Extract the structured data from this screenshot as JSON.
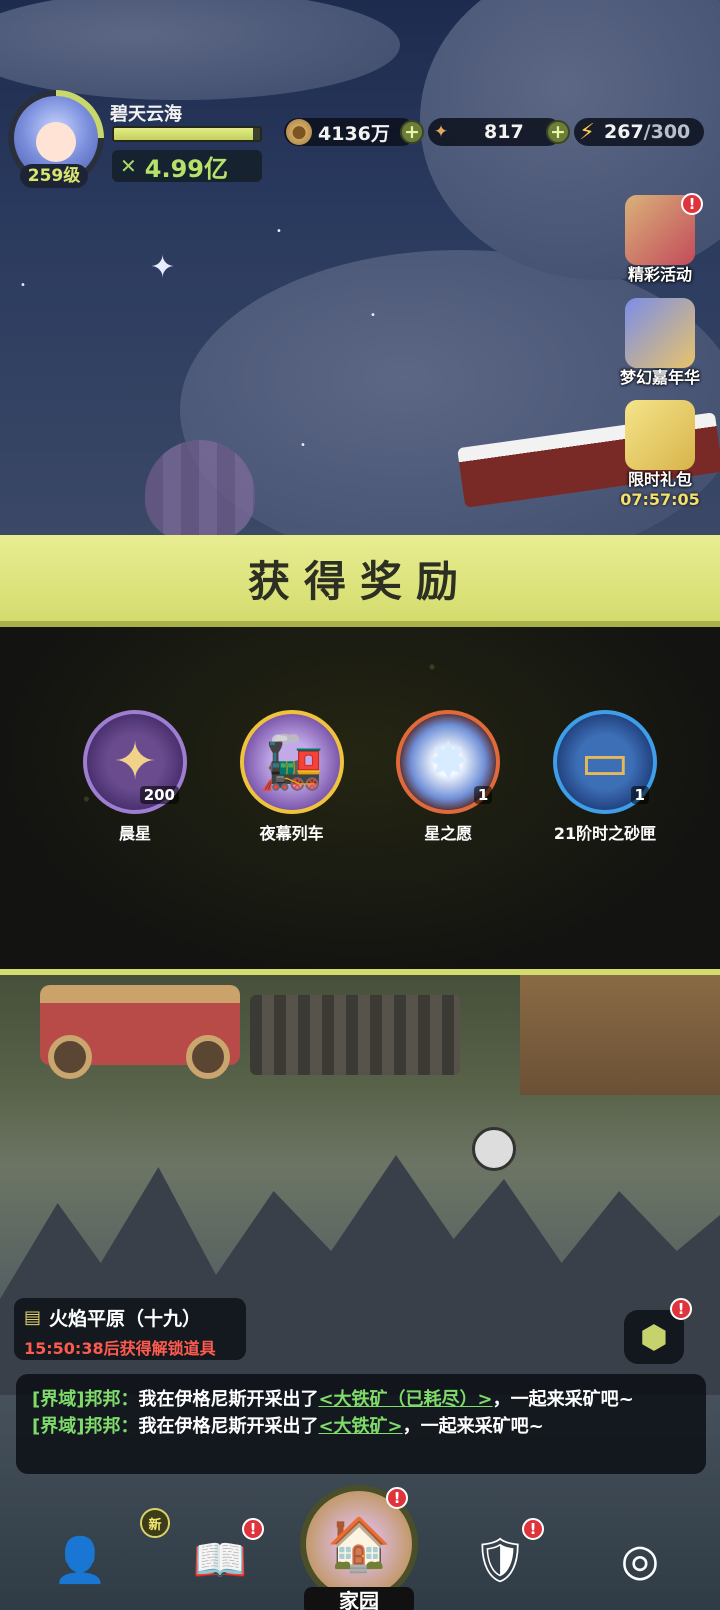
{
  "player": {
    "name": "碧天云海",
    "level": "259级",
    "power": "4.99亿",
    "exp_fraction": 0.95
  },
  "resources": {
    "gold": "4136万",
    "stars": "817",
    "energy_current": "267",
    "energy_max": "/300"
  },
  "events": [
    {
      "label": "精彩活动",
      "badge": "!"
    },
    {
      "label": "梦幻嘉年华"
    },
    {
      "label": "限时礼包",
      "timer": "07:57:05"
    }
  ],
  "reward_popup": {
    "title": "获得奖励",
    "items": [
      {
        "name": "晨星",
        "count": "200",
        "icon": "morning-star-icon"
      },
      {
        "name": "夜幕列车",
        "count": "",
        "icon": "night-train-icon"
      },
      {
        "name": "星之愿",
        "count": "1",
        "icon": "star-wish-icon"
      },
      {
        "name": "21阶时之砂匣",
        "count": "1",
        "icon": "sand-box-icon"
      }
    ]
  },
  "quest": {
    "title": "火焰平原（十九）",
    "timer_text": "15:50:38后获得解锁道具"
  },
  "chat": {
    "lines": [
      {
        "tag": "[界域]邦邦：",
        "prefix": "我在伊格尼斯开采出了",
        "link": "<大铁矿（已耗尽）>",
        "suffix": "，一起来采矿吧~"
      },
      {
        "tag": "[界域]邦邦：",
        "prefix": "我在伊格尼斯开采出了",
        "link": "<大铁矿>",
        "suffix": "，一起来采矿吧~"
      }
    ]
  },
  "nav": {
    "home_label": "家园",
    "new_badge": "新",
    "alert": "!"
  },
  "colors": {
    "accent_yellow": "#d4dc6e",
    "chat_green": "#7fdc6a",
    "timer_red": "#ff5a4e",
    "badge_red": "#e0343c"
  }
}
